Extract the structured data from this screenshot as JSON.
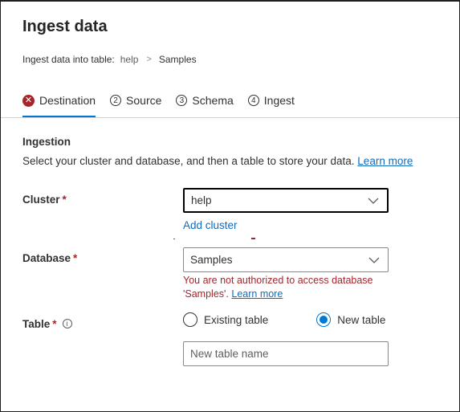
{
  "panel": {
    "title": "Ingest data",
    "breadcrumb": {
      "label": "Ingest data into table:",
      "cluster": "help",
      "separator": ">",
      "database": "Samples"
    }
  },
  "tabs": [
    {
      "number": "",
      "label": "Destination",
      "state": "error"
    },
    {
      "number": "2",
      "label": "Source"
    },
    {
      "number": "3",
      "label": "Schema"
    },
    {
      "number": "4",
      "label": "Ingest"
    }
  ],
  "ingestion": {
    "section_title": "Ingestion",
    "description": "Select your cluster and database, and then a table to store your data.",
    "learn_more": "Learn more"
  },
  "cluster": {
    "label": "Cluster",
    "required": "*",
    "value": "help",
    "add_cluster": "Add cluster"
  },
  "database": {
    "label": "Database",
    "required": "*",
    "value": "Samples",
    "error_text": "You are not authorized to access database 'Samples'.",
    "error_link": "Learn more"
  },
  "table": {
    "label": "Table",
    "required": "*",
    "info_icon": "i",
    "options": {
      "existing": "Existing table",
      "new": "New table"
    },
    "selected": "new",
    "name_placeholder": "New table name"
  },
  "colors": {
    "accent": "#0078d4",
    "link": "#0f6cbd",
    "error": "#a4262c"
  }
}
